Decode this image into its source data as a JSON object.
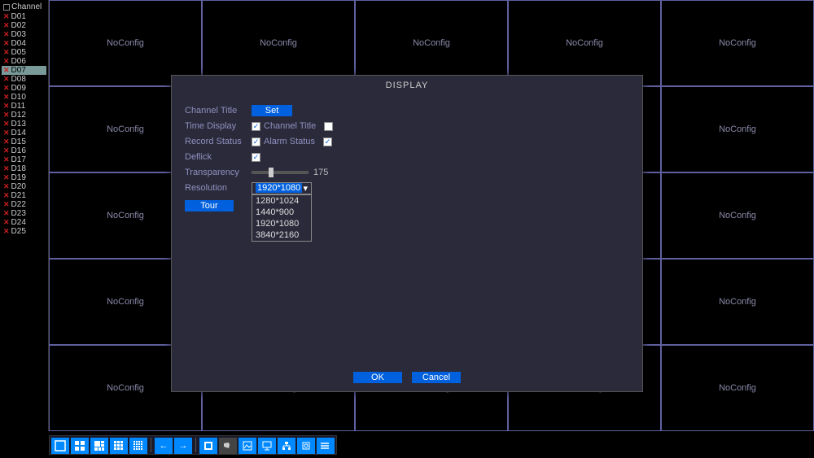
{
  "sidebar": {
    "header": "Channel",
    "items": [
      {
        "label": "D01"
      },
      {
        "label": "D02"
      },
      {
        "label": "D03"
      },
      {
        "label": "D04"
      },
      {
        "label": "D05"
      },
      {
        "label": "D06"
      },
      {
        "label": "D07",
        "selected": true
      },
      {
        "label": "D08"
      },
      {
        "label": "D09"
      },
      {
        "label": "D10"
      },
      {
        "label": "D11"
      },
      {
        "label": "D12"
      },
      {
        "label": "D13"
      },
      {
        "label": "D14"
      },
      {
        "label": "D15"
      },
      {
        "label": "D16"
      },
      {
        "label": "D17"
      },
      {
        "label": "D18"
      },
      {
        "label": "D19"
      },
      {
        "label": "D20"
      },
      {
        "label": "D21"
      },
      {
        "label": "D22"
      },
      {
        "label": "D23"
      },
      {
        "label": "D24"
      },
      {
        "label": "D25"
      }
    ]
  },
  "grid": {
    "cell_label": "NoConfig",
    "rows": 5,
    "cols": 5
  },
  "dialog": {
    "title": "DISPLAY",
    "labels": {
      "channel_title": "Channel Title",
      "time_display": "Time Display",
      "record_status": "Record Status",
      "deflick": "Deflick",
      "transparency": "Transparency",
      "resolution": "Resolution"
    },
    "buttons": {
      "set": "Set",
      "tour": "Tour",
      "ok": "OK",
      "cancel": "Cancel"
    },
    "checkboxes": {
      "time_display": true,
      "channel_title_label": "Channel Title",
      "channel_title_cb": false,
      "record_status": true,
      "alarm_status_label": "Alarm Status",
      "alarm_status": true,
      "deflick": true
    },
    "transparency_value": "175",
    "resolution": {
      "selected": "1920*1080",
      "options": [
        "1280*1024",
        "1440*900",
        "1920*1080",
        "3840*2160"
      ]
    }
  },
  "toolbar_icons": [
    "view-single",
    "view-quad",
    "view-seq",
    "view-9",
    "view-16",
    "nav-prev",
    "nav-next",
    "window",
    "camera",
    "image",
    "monitor",
    "network",
    "disk",
    "list"
  ]
}
